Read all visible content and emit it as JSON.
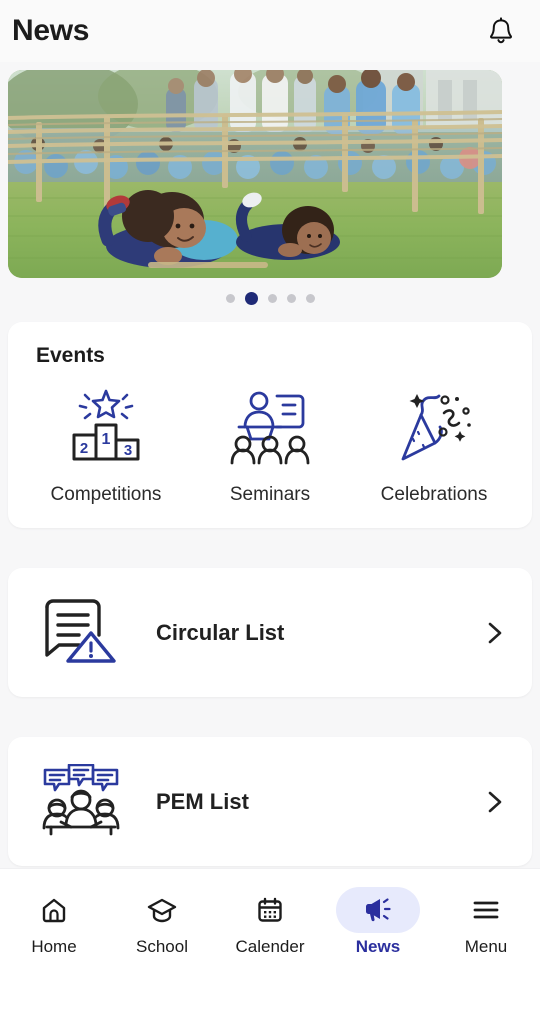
{
  "header": {
    "title": "News",
    "notification_icon": "bell-icon"
  },
  "carousel": {
    "image_alt": "School children crawling under a rope obstacle course on a grass field during a sports event",
    "total_slides": 5,
    "active_slide": 2
  },
  "events": {
    "title": "Events",
    "items": [
      {
        "label": "Competitions",
        "icon": "podium-star-icon"
      },
      {
        "label": "Seminars",
        "icon": "seminar-presenter-icon"
      },
      {
        "label": "Celebrations",
        "icon": "party-popper-icon"
      }
    ]
  },
  "lists": [
    {
      "label": "Circular List",
      "icon": "circular-alert-document-icon",
      "chevron": "chevron-right-icon"
    },
    {
      "label": "PEM List",
      "icon": "meeting-people-chat-icon",
      "chevron": "chevron-right-icon"
    }
  ],
  "bottom_nav": {
    "active": "News",
    "items": [
      {
        "label": "Home",
        "icon": "home-icon",
        "active": false
      },
      {
        "label": "School",
        "icon": "graduation-cap-icon",
        "active": false
      },
      {
        "label": "Calender",
        "icon": "calendar-icon",
        "active": false
      },
      {
        "label": "News",
        "icon": "megaphone-icon",
        "active": true
      },
      {
        "label": "Menu",
        "icon": "hamburger-menu-icon",
        "active": false
      }
    ]
  },
  "colors": {
    "accent_blue": "#2b3a9e",
    "icon_dark": "#222222",
    "active_pill": "#e7eafc",
    "page_background": "#f7f7f8",
    "card_background": "#ffffff"
  }
}
